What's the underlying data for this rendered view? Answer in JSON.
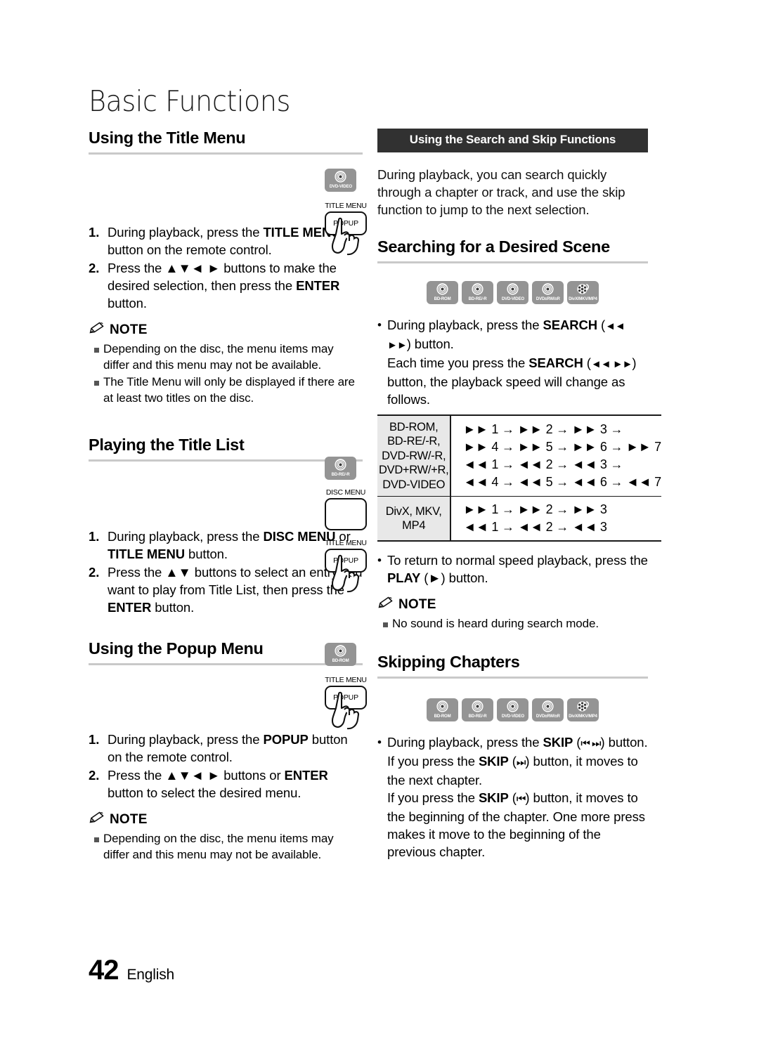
{
  "page": {
    "chapter_title": "Basic Functions",
    "page_number": "42",
    "language": "English"
  },
  "left_column": {
    "section1": {
      "heading": "Using the Title Menu",
      "steps": [
        {
          "num": "1.",
          "html": "During playback, press the <b>TITLE MENU</b> button on the remote control."
        },
        {
          "num": "2.",
          "html": "Press the <b>▲▼◄ ►</b> buttons to make the desired selection, then press the <b>ENTER</b> button."
        }
      ],
      "note_label": "NOTE",
      "notes": [
        "Depending on the disc, the menu items may differ and this menu may not be available.",
        "The Title Menu will only be displayed if there are at least two titles on the disc."
      ],
      "badge": {
        "label": "DVD-VIDEO",
        "icon": "disc-icon"
      },
      "remote": {
        "top_label": "TITLE MENU",
        "button_label": "POPUP",
        "icon": "pointing-hand-icon"
      }
    },
    "section2": {
      "heading": "Playing the Title List",
      "steps": [
        {
          "num": "1.",
          "html": "During playback, press the <b>DISC MENU</b> or <b>TITLE MENU</b> button."
        },
        {
          "num": "2.",
          "html": "Press the <b>▲▼</b> buttons to select an entry you want to play from Title List, then press the <b>ENTER</b> button."
        }
      ],
      "badge": {
        "label": "BD-RE/-R",
        "icon": "disc-icon"
      },
      "remote_disc": {
        "top_label": "DISC MENU",
        "button_label": ""
      },
      "remote_title": {
        "top_label": "TITLE MENU",
        "button_label": "POPUP",
        "icon": "pointing-hand-icon"
      }
    },
    "section3": {
      "heading": "Using the Popup Menu",
      "steps": [
        {
          "num": "1.",
          "html": "During playback, press the <b>POPUP</b> button on the remote control."
        },
        {
          "num": "2.",
          "html": "Press the <b>▲▼◄ ►</b> buttons or <b>ENTER</b> button to select the desired menu."
        }
      ],
      "note_label": "NOTE",
      "notes": [
        "Depending on the disc, the menu items may differ and this menu may not be available."
      ],
      "badge": {
        "label": "BD-ROM",
        "icon": "disc-icon"
      },
      "remote": {
        "top_label": "TITLE MENU",
        "button_label": "POPUP",
        "icon": "pointing-hand-icon"
      }
    }
  },
  "right_column": {
    "banner": "Using the Search and Skip Functions",
    "intro": "During playback, you can search quickly through a chapter or track, and use the skip function to jump to the next selection.",
    "section_search": {
      "heading": "Searching for a Desired Scene",
      "badges": [
        {
          "label": "BD-ROM",
          "icon": "disc-icon"
        },
        {
          "label": "BD-RE/-R",
          "icon": "disc-icon"
        },
        {
          "label": "DVD-VIDEO",
          "icon": "disc-icon"
        },
        {
          "label": "DVD±RW/±R",
          "icon": "disc-icon"
        },
        {
          "label": "DivX/MKV/MP4",
          "icon": "film-reel-icon"
        }
      ],
      "bullets": [
        "During playback, press the <b>SEARCH</b> (<span class=\"ffs\">◄◄ ►►</span>) button.<br>Each time you press the <b>SEARCH</b> (<span class=\"ffs\">◄◄ ►►</span>) button, the playback speed will change as follows."
      ],
      "table": {
        "rows": [
          {
            "key": [
              "BD-ROM,",
              "BD-RE/-R,",
              "DVD-RW/-R,",
              "DVD+RW/+R,",
              "DVD-VIDEO"
            ],
            "lines": [
              "►► 1 → ►► 2 → ►► 3 →",
              "►► 4 → ►► 5 → ►► 6 → ►► 7",
              "◄◄ 1 → ◄◄ 2 → ◄◄ 3 →",
              "◄◄ 4 → ◄◄ 5 → ◄◄ 6 → ◄◄ 7"
            ]
          },
          {
            "key": [
              "DivX, MKV, MP4"
            ],
            "lines": [
              "►► 1 → ►► 2 → ►► 3",
              "◄◄ 1 → ◄◄ 2 → ◄◄ 3"
            ]
          }
        ]
      },
      "bullet_return": "To return to normal speed playback, press the <b>PLAY</b> (►) button.",
      "note_label": "NOTE",
      "notes": [
        "No sound is heard during search mode."
      ]
    },
    "section_skip": {
      "heading": "Skipping Chapters",
      "badges": [
        {
          "label": "BD-ROM",
          "icon": "disc-icon"
        },
        {
          "label": "BD-RE/-R",
          "icon": "disc-icon"
        },
        {
          "label": "DVD-VIDEO",
          "icon": "disc-icon"
        },
        {
          "label": "DVD±RW/±R",
          "icon": "disc-icon"
        },
        {
          "label": "DivX/MKV/MP4",
          "icon": "film-reel-icon"
        }
      ],
      "bullet": "During playback, press the <b>SKIP</b> (<span class=\"ffs\">⏮ ⏭</span>) button.<br>If you press the <b>SKIP</b> (<span class=\"ffs\">⏭</span>) button, it moves to the next chapter.<br>If you press the <b>SKIP</b> (<span class=\"ffs\">⏮</span>) button, it moves to the beginning of the chapter. One more press makes it move to the beginning of the previous chapter."
    }
  },
  "colors": {
    "banner_bg": "#313131",
    "badge_bg": "#949494",
    "rule": "#c9c9c9",
    "table_key_bg": "#e8e8e8"
  }
}
